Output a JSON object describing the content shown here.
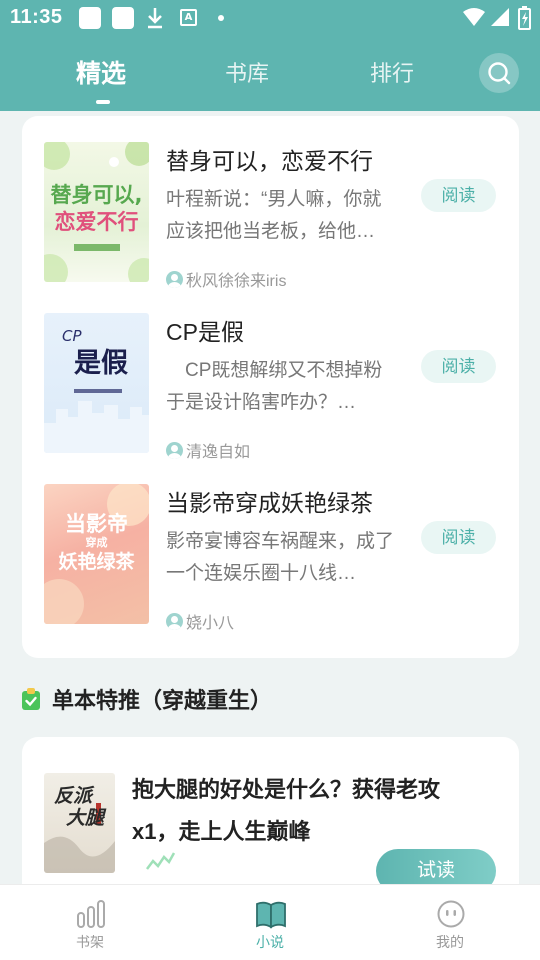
{
  "status_bar": {
    "time": "11:35"
  },
  "tabs": [
    {
      "label": "精选",
      "active": true
    },
    {
      "label": "书库",
      "active": false
    },
    {
      "label": "排行",
      "active": false
    }
  ],
  "books": [
    {
      "title": "替身可以，恋爱不行",
      "description": "叶程新说：“男人嘛，你就应该把他当老板，给他…",
      "author": "秋风徐徐来iris",
      "action": "阅读",
      "cover_text": [
        "替身可以,",
        "恋爱不行"
      ]
    },
    {
      "title": "CP是假",
      "description": "　CP既想解绑又不想掉粉于是设计陷害咋办？…",
      "author": "清逸自如",
      "action": "阅读",
      "cover_text": [
        "CP",
        "是假"
      ]
    },
    {
      "title": "当影帝穿成妖艳绿茶",
      "description": "影帝宴博容车祸醒来，成了一个连娱乐圈十八线…",
      "author": "娆小八",
      "action": "阅读",
      "cover_text": [
        "当影帝",
        "穿成",
        "妖艳绿茶"
      ]
    }
  ],
  "section": {
    "title": "单本特推（穿越重生）"
  },
  "featured": {
    "title": "抱大腿的好处是什么？获得老攻x1，走上人生巅峰",
    "action": "试读",
    "cover_text": [
      "反派",
      "大腿"
    ]
  },
  "bottom_nav": [
    {
      "label": "书架",
      "icon": "bookshelf-icon",
      "active": false
    },
    {
      "label": "小说",
      "icon": "book-icon",
      "active": true
    },
    {
      "label": "我的",
      "icon": "profile-icon",
      "active": false
    }
  ],
  "colors": {
    "primary": "#5eb5b0",
    "accent_text": "#4cb0a8",
    "background": "#eef3f3"
  }
}
